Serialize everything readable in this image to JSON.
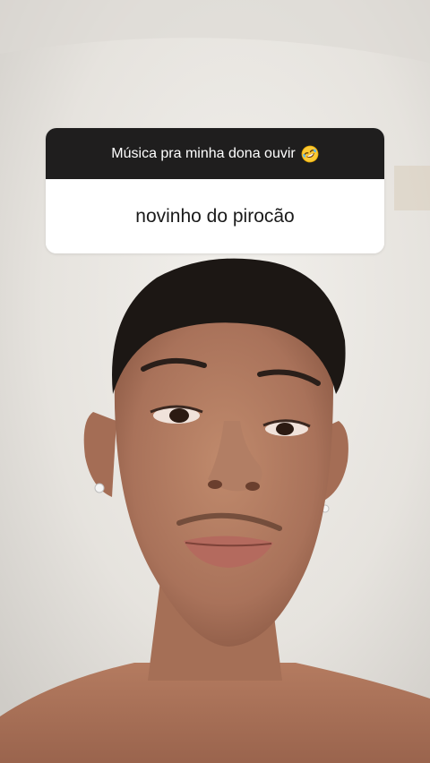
{
  "story": {
    "question_sticker": {
      "prompt": "Música pra minha dona ouvir",
      "prompt_emoji": "rolling-on-the-floor-laughing-icon",
      "answer": "novinho do pirocão",
      "header_color": "#1f1e1e",
      "body_color": "#ffffff"
    }
  }
}
